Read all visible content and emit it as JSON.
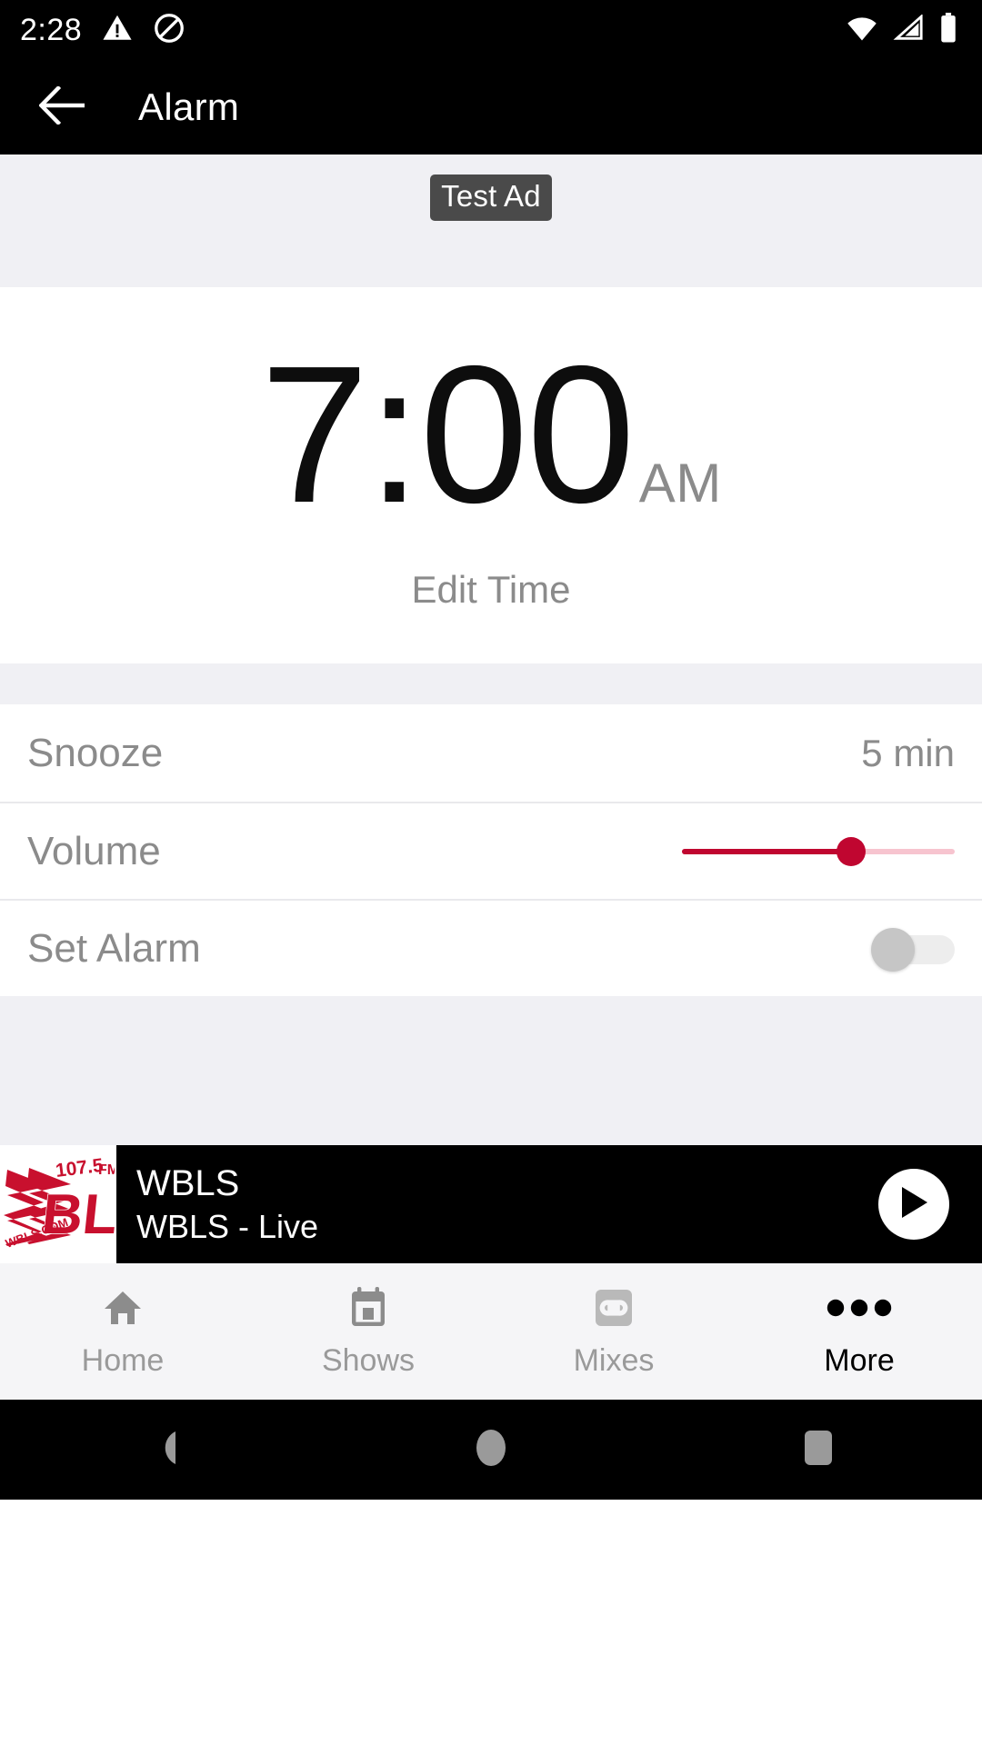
{
  "status_bar": {
    "time": "2:28",
    "left_icons": [
      "warning-triangle-icon",
      "do-not-disturb-icon"
    ],
    "right_icons": [
      "wifi-icon",
      "cellular-signal-icon",
      "battery-icon"
    ]
  },
  "app_bar": {
    "back_icon": "arrow-left-icon",
    "title": "Alarm"
  },
  "ad": {
    "badge_label": "Test Ad",
    "background_color": "#f0f0f4"
  },
  "alarm": {
    "time": "7:00",
    "meridiem": "AM",
    "edit_label": "Edit Time"
  },
  "settings": {
    "snooze": {
      "label": "Snooze",
      "value": "5 min"
    },
    "volume": {
      "label": "Volume",
      "percent": 62,
      "active_color": "#c00630",
      "inactive_color": "#f7c4cf"
    },
    "set_alarm": {
      "label": "Set Alarm",
      "state": "off"
    }
  },
  "player": {
    "station": "WBLS",
    "subtitle": "WBLS - Live",
    "logo_frequency": "107.5",
    "logo_band": "FM",
    "logo_letters": "BLS",
    "logo_site": "WBLS.COM",
    "logo_color": "#c8102e",
    "play_icon": "play-icon"
  },
  "bottom_nav": {
    "items": [
      {
        "label": "Home",
        "icon": "home-icon",
        "active": false
      },
      {
        "label": "Shows",
        "icon": "calendar-icon",
        "active": false
      },
      {
        "label": "Mixes",
        "icon": "cassette-icon",
        "active": false
      },
      {
        "label": "More",
        "icon": "more-dots-icon",
        "active": true
      }
    ]
  },
  "system_nav": {
    "back_icon": "triangle-back-icon",
    "home_icon": "circle-home-icon",
    "recents_icon": "square-recents-icon"
  }
}
